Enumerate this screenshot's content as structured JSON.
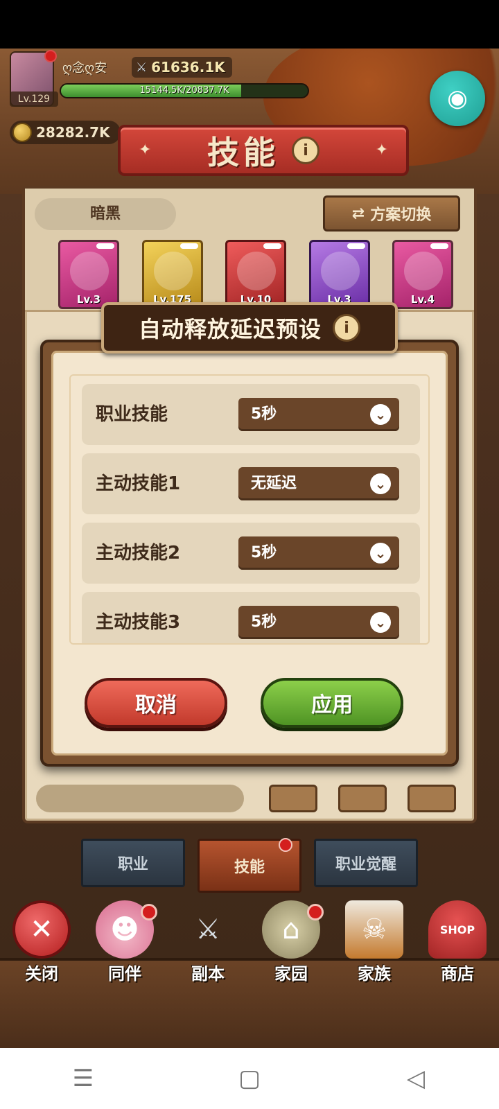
{
  "player": {
    "name": "ღ念ღ安",
    "level_label": "Lv.129",
    "power": "61636.1K",
    "xp_text": "15144.5K/20837.7K",
    "xp_fraction": 0.73,
    "coins": "28282.7K"
  },
  "header": {
    "title": "技能"
  },
  "skill_panel": {
    "preset_name": "暗黑",
    "switch_label": "方案切换",
    "skills": [
      {
        "level": "Lv.3",
        "color": "pink"
      },
      {
        "level": "Lv.175",
        "color": "gold"
      },
      {
        "level": "Lv.10",
        "color": "red"
      },
      {
        "level": "Lv.3",
        "color": "purple"
      },
      {
        "level": "Lv.4",
        "color": "pink"
      }
    ]
  },
  "modal": {
    "title": "自动释放延迟预设",
    "rows": [
      {
        "label": "职业技能",
        "value": "5秒"
      },
      {
        "label": "主动技能1",
        "value": "无延迟"
      },
      {
        "label": "主动技能2",
        "value": "5秒"
      },
      {
        "label": "主动技能3",
        "value": "5秒"
      }
    ],
    "cancel_label": "取消",
    "apply_label": "应用"
  },
  "tabs": [
    {
      "label": "职业",
      "active": false
    },
    {
      "label": "技能",
      "active": true
    },
    {
      "label": "职业觉醒",
      "active": false
    }
  ],
  "bottom_nav": [
    {
      "label": "关闭",
      "icon": "close-icon"
    },
    {
      "label": "同伴",
      "icon": "companion-icon"
    },
    {
      "label": "副本",
      "icon": "crossed-swords-icon"
    },
    {
      "label": "家园",
      "icon": "homestead-icon"
    },
    {
      "label": "家族",
      "icon": "clan-icon"
    },
    {
      "label": "商店",
      "icon": "shop-icon"
    }
  ],
  "shop_sign": "SHOP",
  "colors": {
    "accent_red": "#d4473b",
    "apply_green": "#6db338",
    "cancel_red": "#d84b3c",
    "modal_bg": "#f3e6cf"
  }
}
